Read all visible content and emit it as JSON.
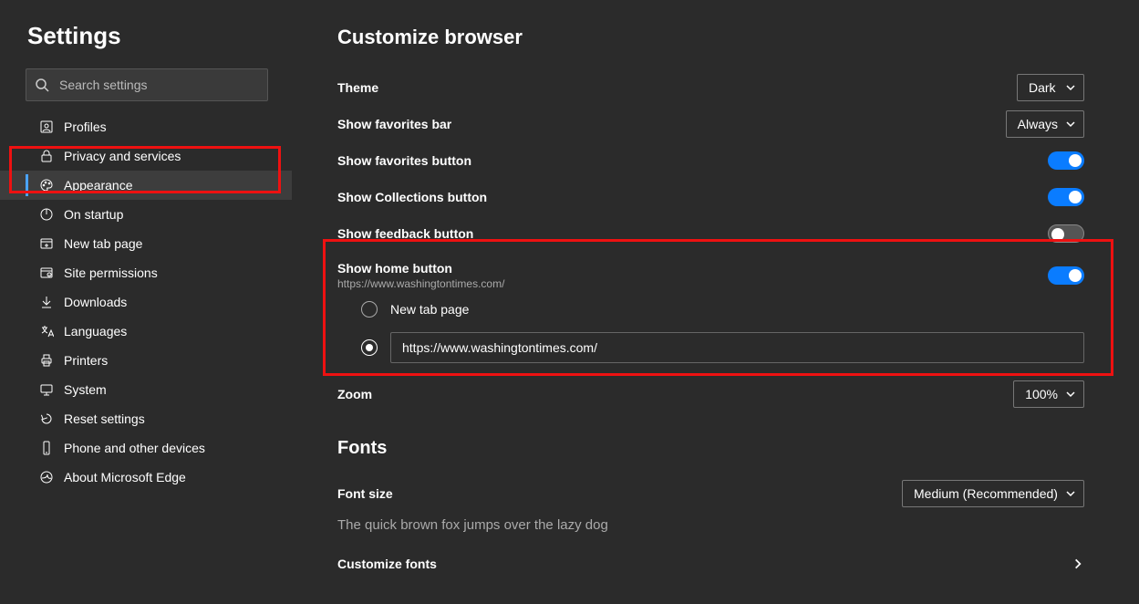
{
  "sidebar": {
    "title": "Settings",
    "search_placeholder": "Search settings",
    "items": [
      {
        "label": "Profiles"
      },
      {
        "label": "Privacy and services"
      },
      {
        "label": "Appearance"
      },
      {
        "label": "On startup"
      },
      {
        "label": "New tab page"
      },
      {
        "label": "Site permissions"
      },
      {
        "label": "Downloads"
      },
      {
        "label": "Languages"
      },
      {
        "label": "Printers"
      },
      {
        "label": "System"
      },
      {
        "label": "Reset settings"
      },
      {
        "label": "Phone and other devices"
      },
      {
        "label": "About Microsoft Edge"
      }
    ]
  },
  "main": {
    "section_title": "Customize browser",
    "theme_label": "Theme",
    "theme_value": "Dark",
    "favorites_bar_label": "Show favorites bar",
    "favorites_bar_value": "Always",
    "favorites_button_label": "Show favorites button",
    "collections_button_label": "Show Collections button",
    "feedback_button_label": "Show feedback button",
    "home_button_label": "Show home button",
    "home_button_sub": "https://www.washingtontimes.com/",
    "home_radio_newtab": "New tab page",
    "home_radio_url_value": "https://www.washingtontimes.com/",
    "zoom_label": "Zoom",
    "zoom_value": "100%",
    "fonts_title": "Fonts",
    "font_size_label": "Font size",
    "font_size_value": "Medium (Recommended)",
    "font_sample": "The quick brown fox jumps over the lazy dog",
    "customize_fonts_label": "Customize fonts"
  }
}
